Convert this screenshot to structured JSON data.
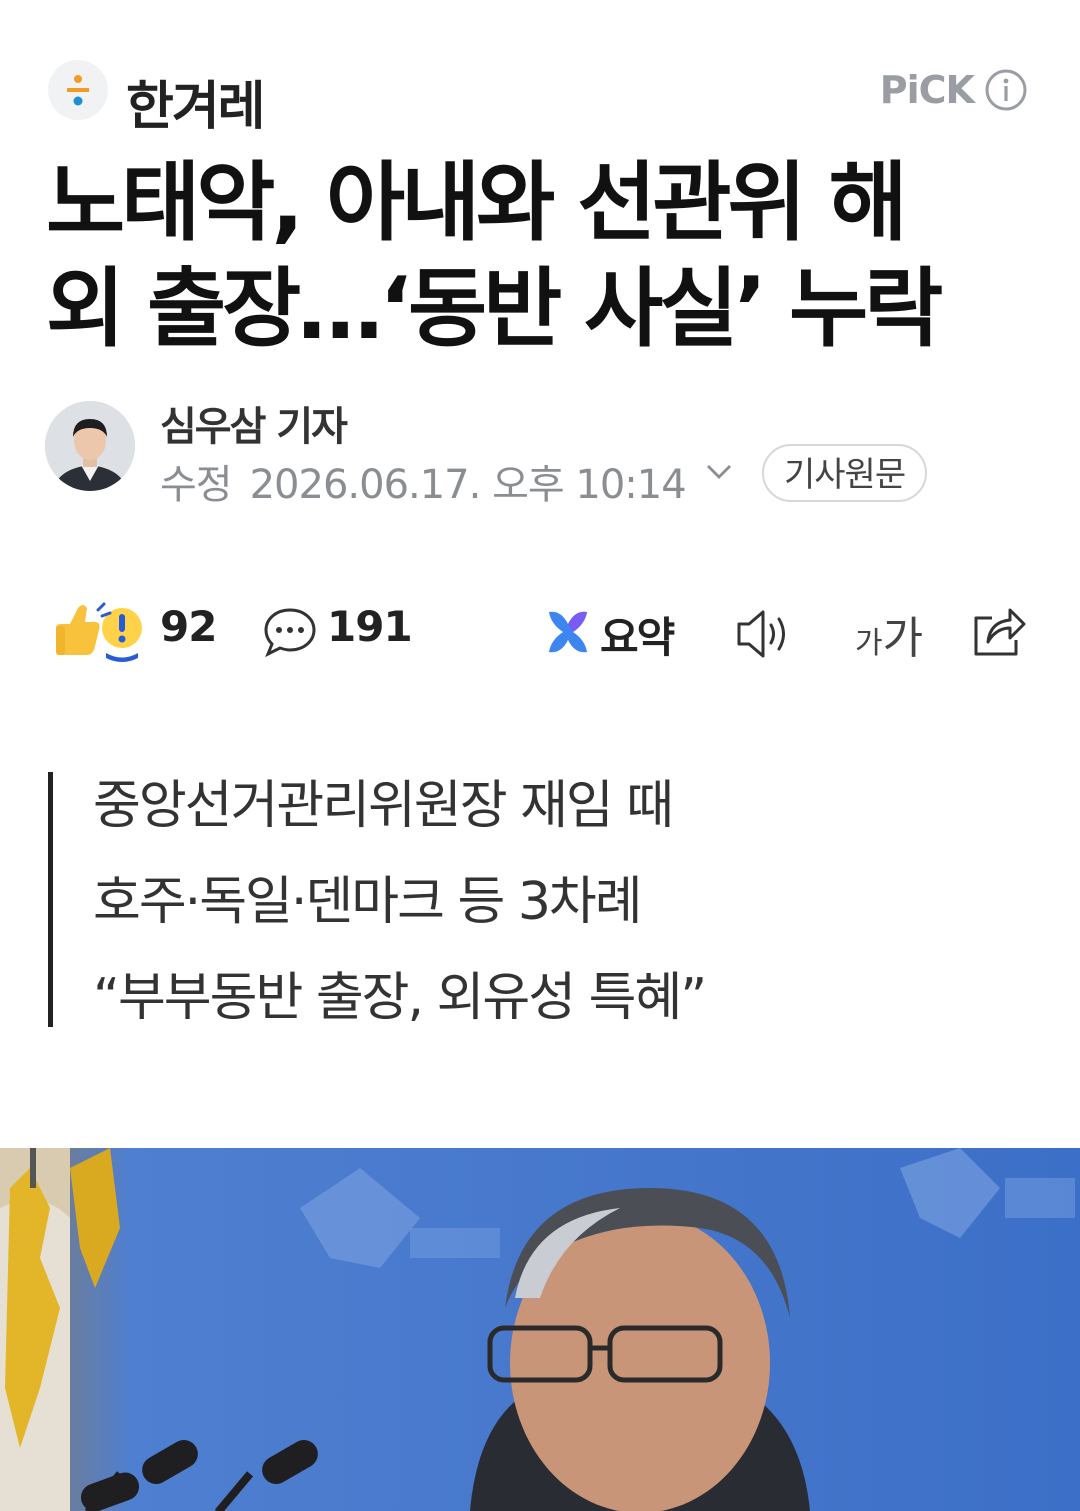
{
  "press": {
    "name": "한겨레",
    "pick_label": "PiCK",
    "info_icon": "info-circle-icon"
  },
  "article": {
    "headline_line1": "노태악, 아내와 선관위 해",
    "headline_line2": "외 출장…‘동반 사실’ 누락",
    "author": "심우삼 기자",
    "date_label": "수정",
    "date": "2026.06.17. 오후 10:14",
    "original_button": "기사원문",
    "subheadings": [
      "중앙선거관리위원장 재임 때",
      "호주·독일·덴마크 등 3차례",
      "“부부동반 출장, 외유성 특혜”"
    ]
  },
  "actions": {
    "reaction_count": "92",
    "comment_count": "191",
    "summary_label": "요약",
    "font_small": "가",
    "font_large": "가",
    "icons": [
      "reaction-icon",
      "comment-icon",
      "summary-icon",
      "speaker-icon",
      "font-size-icon",
      "share-icon"
    ]
  },
  "colors": {
    "brand_dot_orange": "#f59a23",
    "brand_dot_blue": "#1d8fd6",
    "photo_background": "#3f74c9"
  }
}
